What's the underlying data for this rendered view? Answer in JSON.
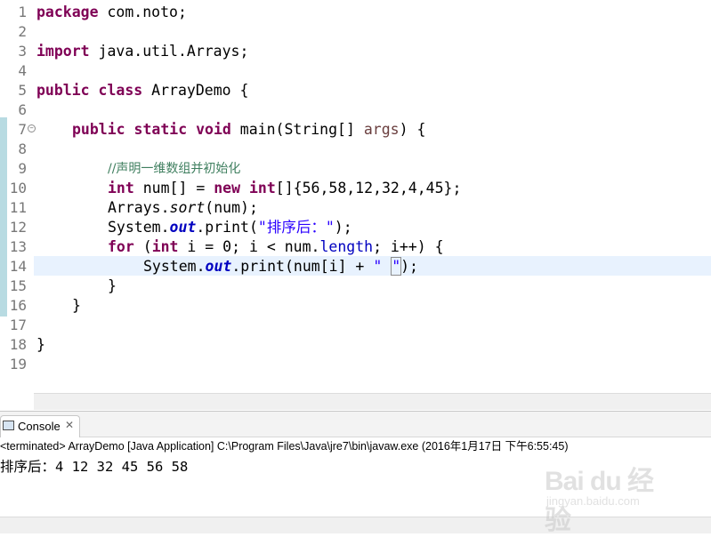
{
  "editor": {
    "line_numbers": [
      "1",
      "2",
      "3",
      "4",
      "5",
      "6",
      "7",
      "8",
      "9",
      "10",
      "11",
      "12",
      "13",
      "14",
      "15",
      "16",
      "17",
      "18",
      "19"
    ],
    "code": {
      "l1_kw": "package",
      "l1_rest": " com.noto;",
      "l3_kw": "import",
      "l3_rest": " java.util.Arrays;",
      "l5_kw1": "public",
      "l5_kw2": "class",
      "l5_rest": " ArrayDemo {",
      "l7_kw1": "public",
      "l7_kw2": "static",
      "l7_kw3": "void",
      "l7_a": " main(String[] ",
      "l7_param": "args",
      "l7_b": ") {",
      "l9_comment": "//声明一维数组并初始化",
      "l10_kw1": "int",
      "l10_a": " num[] = ",
      "l10_kw2": "new",
      "l10_kw3": "int",
      "l10_b": "[]{56,58,12,32,4,45};",
      "l11_a": "Arrays.",
      "l11_method": "sort",
      "l11_b": "(num);",
      "l12_a": "System.",
      "l12_field": "out",
      "l12_b": ".print(",
      "l12_str": "\"排序后：\"",
      "l12_c": ");",
      "l13_kw1": "for",
      "l13_a": " (",
      "l13_kw2": "int",
      "l13_b": " i = 0; i < num.",
      "l13_field": "length",
      "l13_c": "; i++) {",
      "l14_a": "System.",
      "l14_field": "out",
      "l14_b": ".print(num[i] + ",
      "l14_str1": "\" ",
      "l14_str2": "\"",
      "l14_c": ");",
      "l15": "}",
      "l16": "}",
      "l18": "}"
    }
  },
  "console": {
    "tab_label": "Console",
    "tab_close": "✕",
    "status": "<terminated> ArrayDemo [Java Application] C:\\Program Files\\Java\\jre7\\bin\\javaw.exe (2016年1月17日 下午6:55:45)",
    "output": "排序后：4 12 32 45 56 58"
  },
  "watermark": {
    "brand": "Bai du 经验",
    "site": "jingyan.baidu.com"
  },
  "colors": {
    "keyword": "#7f0055",
    "string": "#2a00ff",
    "comment": "#3f7f5f",
    "field": "#0000c0",
    "current_line": "#e8f2fe"
  }
}
